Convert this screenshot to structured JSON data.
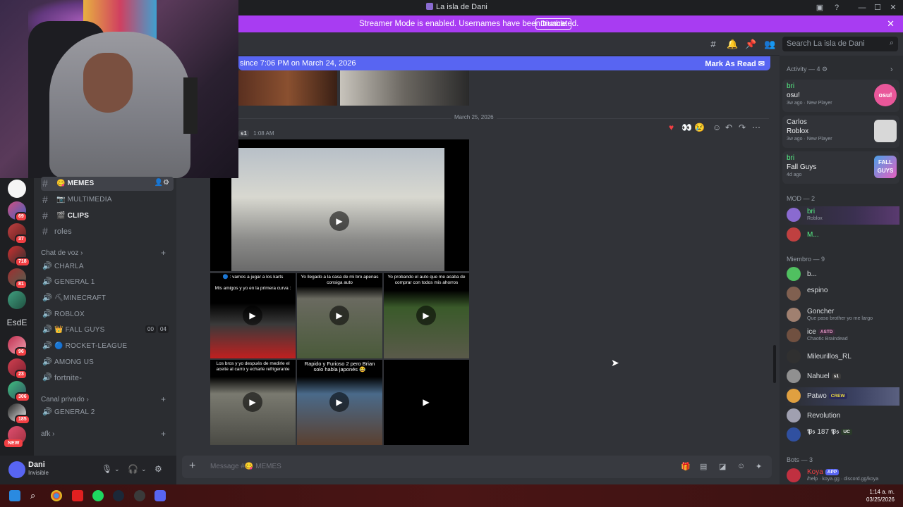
{
  "window": {
    "title": "La isla de Dani"
  },
  "banner": {
    "text": "Streamer Mode is enabled. Usernames have been truncated.",
    "disable": "Disable"
  },
  "search": {
    "placeholder": "Search La isla de Dani"
  },
  "newbar": {
    "since": "since 7:06 PM on March 24, 2026",
    "mark": "Mark As Read"
  },
  "chat": {
    "date": "March 25, 2026",
    "meta_name": "s1",
    "meta_time": "1:08 AM",
    "tiles": [
      {
        "caption": "🔵 : vamos a jugar a los karts\n\nMis amigos y yo en la primera curva :"
      },
      {
        "caption": "Yo llegado a la casa de mi bro apenas consiga auto"
      },
      {
        "caption": "Yo probando el auto que me acaba de comprar con todos mis ahorros"
      },
      {
        "caption": "Los bros y yo después de medirle el aceite al carro y echarle refrigerante"
      },
      {
        "caption": "Rapido y Furioso 2 pero Brian solo habla japonés 😂"
      },
      {
        "caption": ""
      }
    ]
  },
  "channels": {
    "memes": "MEMES",
    "multimedia": "MULTIMEDIA",
    "clips": "CLIPS",
    "roles": "roles",
    "voice_cat": "Chat de voz",
    "voice": [
      "CHARLA",
      "GENERAL 1",
      "⛏MINECRAFT",
      "ROBLOX",
      "👑 FALL GUYS",
      "🔵 ROCKET-LEAGUE",
      "AMONG US",
      "fortnite-"
    ],
    "fallguys_counts": [
      "00",
      "04"
    ],
    "private_cat": "Canal privado",
    "private": [
      "GENERAL 2"
    ],
    "afk_cat": "afk"
  },
  "servers": {
    "badges": [
      "69",
      "37",
      "718",
      "81",
      "96",
      "23",
      "306",
      "185"
    ],
    "esde": "EsdE",
    "new": "NEW"
  },
  "user": {
    "name": "Dani",
    "status": "Invisible"
  },
  "composer": {
    "placeholder": "Message #😋 MEMES"
  },
  "members": {
    "activity_header": "Activity — 4",
    "activities": [
      {
        "name": "bri",
        "game": "osu!",
        "time": "3w ago",
        "extra": "New Player",
        "color": "#e9579a"
      },
      {
        "name": "Carlos",
        "game": "Roblox",
        "time": "3w ago",
        "extra": "New Player",
        "color": "#d8d8d8"
      },
      {
        "name": "bri",
        "game": "Fall Guys",
        "time": "4d ago",
        "extra": "",
        "color": "#4aa0e8"
      }
    ],
    "mod_header": "MOD — 2",
    "mods": [
      {
        "name": "bri",
        "sub": "Roblox",
        "color": "#57f287"
      },
      {
        "name": "M...",
        "sub": "",
        "color": "#57f287"
      }
    ],
    "member_header": "Miembro — 9",
    "list": [
      {
        "name": "b...",
        "sub": "",
        "tag": ""
      },
      {
        "name": "espino",
        "sub": "",
        "tag": ""
      },
      {
        "name": "Goncher",
        "sub": "Que paso brother yo me largo",
        "tag": ""
      },
      {
        "name": "ice",
        "sub": "Chaotic Braindead",
        "tag": "ASTD"
      },
      {
        "name": "Mileurillos_RL",
        "sub": "",
        "tag": ""
      },
      {
        "name": "Nahuel",
        "sub": "",
        "tag": "s1"
      },
      {
        "name": "Patwo",
        "sub": "",
        "tag": "CREW"
      },
      {
        "name": "Revolution",
        "sub": "",
        "tag": ""
      },
      {
        "name": "𝕻𝖘 187 𝕻𝖘",
        "sub": "",
        "tag": "UC"
      }
    ],
    "bots_header": "Bots — 3",
    "bot": {
      "name": "Koya",
      "tag": "APP",
      "sub": "/help · koya.gg · discord.gg/koya"
    }
  },
  "clock": {
    "time": "1:14 a. m.",
    "date": "03/25/2026"
  }
}
